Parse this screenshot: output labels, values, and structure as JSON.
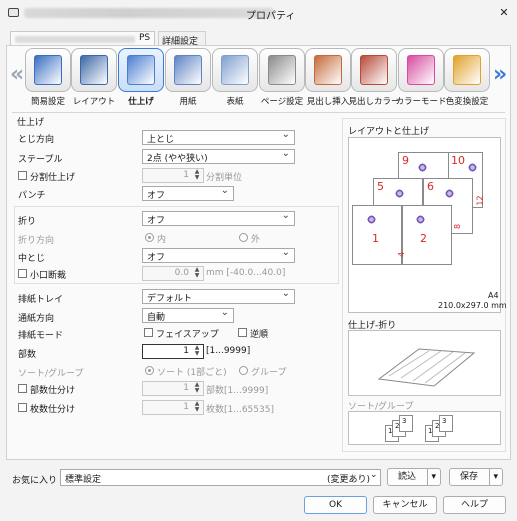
{
  "window": {
    "title_suffix": "プロパティ",
    "close_glyph": "✕",
    "printer_icon": "printer-icon"
  },
  "tabs": [
    {
      "label_suffix": "PS"
    },
    {
      "label": "詳細設定"
    }
  ],
  "toolbar": {
    "items": [
      {
        "label": "簡易設定",
        "icon": "easy-setup-icon",
        "color": "#3a6ec2"
      },
      {
        "label": "レイアウト",
        "icon": "layout-icon",
        "color": "#3c67a6"
      },
      {
        "label": "仕上げ",
        "icon": "finishing-icon",
        "color": "#4a7fd0"
      },
      {
        "label": "用紙",
        "icon": "paper-icon",
        "color": "#5f84c4"
      },
      {
        "label": "表紙",
        "icon": "cover-icon",
        "color": "#7fa0cf"
      },
      {
        "label": "ページ設定",
        "icon": "page-setup-icon",
        "color": "#8a8a8a"
      },
      {
        "label": "見出し挿入",
        "icon": "insert-tab-icon",
        "color": "#c46a3a"
      },
      {
        "label": "見出しカラー",
        "icon": "tab-color-icon",
        "color": "#b74a3a"
      },
      {
        "label": "カラーモード",
        "icon": "color-mode-icon",
        "color": "#d84aa0"
      },
      {
        "label": "色変換設定",
        "icon": "color-convert-icon",
        "color": "#e0a22a"
      }
    ],
    "prev_glyph": "«",
    "next_glyph": "»"
  },
  "finishing": {
    "section": "仕上げ",
    "binding_label": "とじ方向",
    "binding_value": "上とじ",
    "staple_label": "ステープル",
    "staple_value": "2点 (やや狭い)",
    "split_label": "分割仕上げ",
    "split_value": "1",
    "split_unit": "分割単位",
    "punch_label": "パンチ",
    "punch_value": "オフ",
    "fold_label": "折り",
    "fold_value": "オフ",
    "fold_dir_label": "折り方向",
    "fold_in": "内",
    "fold_out": "外",
    "saddle_label": "中とじ",
    "saddle_value": "オフ",
    "trim_label": "小口断裁",
    "trim_value": "0.0",
    "trim_range": "mm [-40.0...40.0]",
    "tray_label": "排紙トレイ",
    "tray_value": "デフォルト",
    "feed_label": "通紙方向",
    "feed_value": "自動",
    "output_label": "排紙モード",
    "faceup_label": "フェイスアップ",
    "reverse_label": "逆順",
    "copies_label": "部数",
    "copies_value": "1",
    "copies_range": "[1...9999]",
    "sort_label": "ソート/グループ",
    "sort_value": "ソート (1部ごと)",
    "group_value": "グループ",
    "set_div_label": "部数仕分け",
    "set_div_value": "1",
    "set_div_range": "部数[1...9999]",
    "sheet_div_label": "枚数仕分け",
    "sheet_div_value": "1",
    "sheet_div_range": "枚数[1...65535]"
  },
  "preview": {
    "layout_title": "レイアウトと仕上げ",
    "pages": [
      "9",
      "10",
      "5",
      "6",
      "1",
      "2",
      "4",
      "8",
      "12"
    ],
    "paper": "A4",
    "size": "210.0x297.0 mm",
    "fold_title": "仕上げ-折り",
    "sort_title": "ソート/グループ",
    "sort_nums": [
      "1",
      "2",
      "3",
      "1",
      "2",
      "3"
    ]
  },
  "footer": {
    "favorites_label": "お気に入り",
    "favorites_value": "標準設定",
    "favorites_state": "(変更あり)",
    "load_label": "読込",
    "save_label": "保存",
    "ok_label": "OK",
    "cancel_label": "キャンセル",
    "help_label": "ヘルプ"
  }
}
